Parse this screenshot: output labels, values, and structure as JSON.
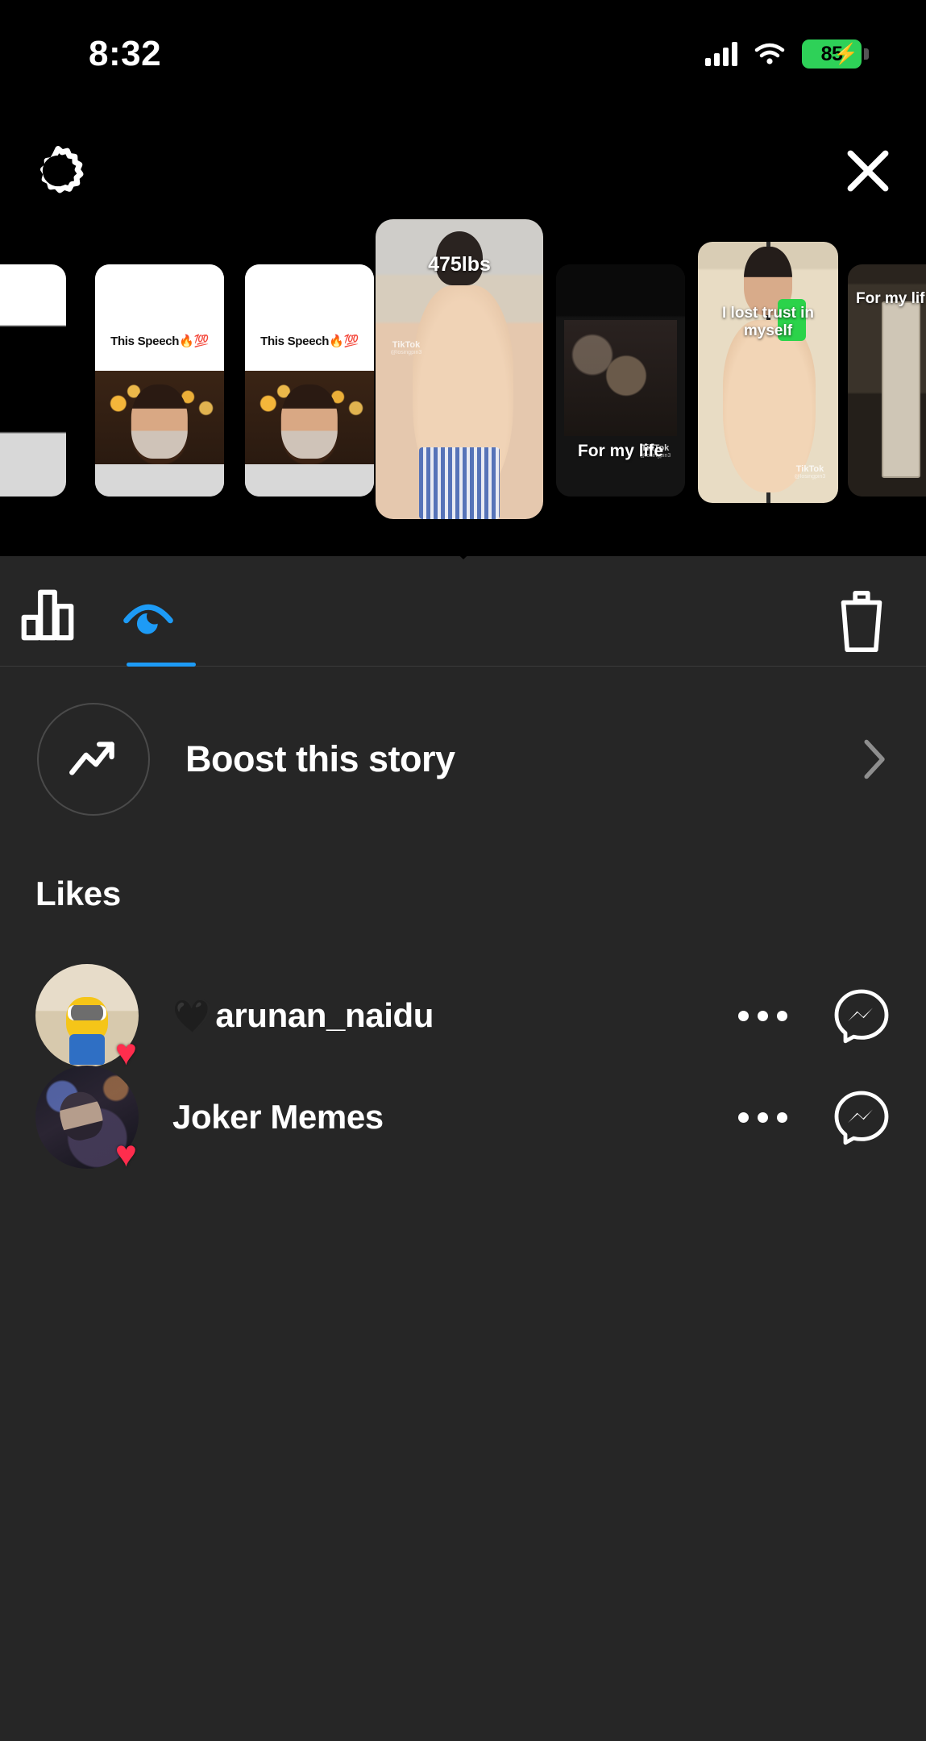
{
  "status_bar": {
    "time": "8:32",
    "battery_level": "85",
    "battery_color": "#2ed158",
    "charging": true,
    "icons": [
      "cellular-signal-icon",
      "wifi-icon",
      "battery-icon"
    ]
  },
  "header": {
    "settings_icon": "gear-icon",
    "close_icon": "close-icon"
  },
  "carousel": {
    "items": [
      {
        "id": 0,
        "caption": "",
        "art": "blackwhite",
        "selected": false,
        "watermark": ""
      },
      {
        "id": 1,
        "caption": "This Speech🔥💯",
        "art": "speech",
        "selected": false,
        "watermark": ""
      },
      {
        "id": 2,
        "caption": "This Speech🔥💯",
        "art": "speech",
        "selected": false,
        "watermark": ""
      },
      {
        "id": 3,
        "caption": "475lbs",
        "art": "body",
        "selected": true,
        "watermark": "TikTok",
        "watermark_sub": "@losingpin3"
      },
      {
        "id": 4,
        "caption": "For my life",
        "art": "dark",
        "selected": false,
        "watermark": "TikTok",
        "watermark_sub": "@losingpin3"
      },
      {
        "id": 5,
        "caption": "I lost trust in myself",
        "art": "mirror",
        "selected": false,
        "watermark": "TikTok",
        "watermark_sub": "@losingpin3"
      },
      {
        "id": 6,
        "caption": "For my lif",
        "art": "room",
        "selected": false,
        "watermark": ""
      }
    ]
  },
  "tabs": {
    "items": [
      {
        "name": "insights",
        "icon": "bar-chart-icon",
        "selected": false,
        "color": "#ffffff"
      },
      {
        "name": "viewers",
        "icon": "eye-icon",
        "selected": true,
        "color": "#1d9bf6"
      }
    ],
    "delete_icon": "trash-icon",
    "active_color": "#1d9bf6"
  },
  "boost": {
    "label": "Boost this story",
    "icon": "trending-up-icon",
    "chevron": "chevron-right-icon"
  },
  "likes": {
    "title": "Likes",
    "rows": [
      {
        "username": "arunan_naidu",
        "prefix_emoji": "🖤",
        "avatar": "minion",
        "reaction": "♥",
        "reaction_color": "#ff2d4d",
        "more_icon": "more-options-icon",
        "message_icon": "messenger-icon"
      },
      {
        "username": "Joker Memes",
        "prefix_emoji": "",
        "avatar": "joker",
        "reaction": "♥",
        "reaction_color": "#ff2d4d",
        "more_icon": "more-options-icon",
        "message_icon": "messenger-icon"
      }
    ]
  },
  "colors": {
    "background": "#262626",
    "panel": "#000000",
    "accent": "#1d9bf6",
    "text": "#ffffff"
  }
}
